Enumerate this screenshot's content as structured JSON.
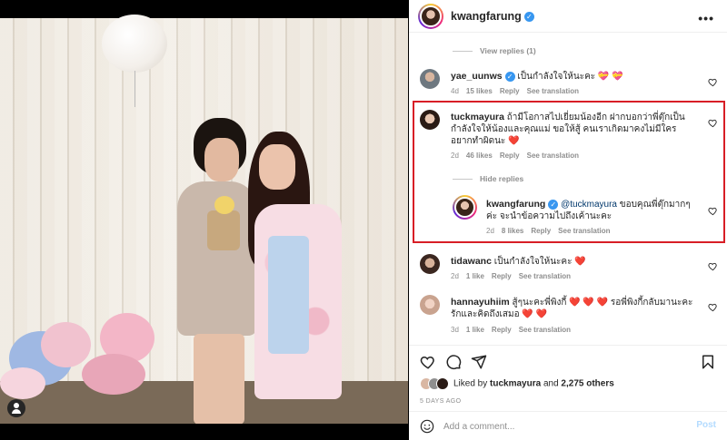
{
  "post": {
    "author": "kwangfarung",
    "more_icon": "more-horizontal-icon"
  },
  "thread": {
    "view_replies": "View replies (1)",
    "hide_replies": "Hide replies"
  },
  "comments": [
    {
      "user": "yae_uunws",
      "verified": true,
      "text": "เป็นกำลังใจให้นะคะ 💝 💝",
      "age": "4d",
      "likes": "15 likes",
      "reply": "Reply",
      "translate": "See translation"
    },
    {
      "user": "tuckmayura",
      "verified": false,
      "text": "ถ้ามีโอกาสไปเยี่ยมน้องอีก ฝากบอกว่าพี่ตุ๊กเป็นกำลังใจให้น้องและคุณแม่ ขอให้สู้ คนเราเกิดมาคงไม่มีใครอยากทำผิดนะ ❤️",
      "age": "2d",
      "likes": "46 likes",
      "reply": "Reply",
      "translate": "See translation"
    },
    {
      "user": "kwangfarung",
      "verified": true,
      "mention": "@tuckmayura",
      "text": " ขอบคุณพี่ตุ๊กมากๆค่ะ จะนำข้อความไปถึงเค้านะคะ",
      "age": "2d",
      "likes": "8 likes",
      "reply": "Reply",
      "translate": "See translation"
    },
    {
      "user": "tidawanc",
      "verified": false,
      "text": "เป็นกำลังใจให้นะคะ ❤️",
      "age": "2d",
      "likes": "1 like",
      "reply": "Reply",
      "translate": "See translation"
    },
    {
      "user": "hannayuhiim",
      "verified": false,
      "text": "สู้ๆนะคะพี่พิงกี้ ❤️ ❤️ ❤️ รอพี่พิงกี้กลับมานะคะ รักและคิดถึงเสมอ ❤️ ❤️",
      "age": "3d",
      "likes": "1 like",
      "reply": "Reply",
      "translate": "See translation"
    }
  ],
  "likes": {
    "prefix": "Liked by ",
    "by": "tuckmayura",
    "and": " and ",
    "others": "2,275 others"
  },
  "timestamp": "5 DAYS AGO",
  "composer": {
    "placeholder": "Add a comment...",
    "post_label": "Post"
  },
  "colors": {
    "verified": "#3897f0",
    "highlight_border": "#d81e26",
    "heart_red": "#ed4956",
    "muted_text": "#8e8e8e"
  }
}
